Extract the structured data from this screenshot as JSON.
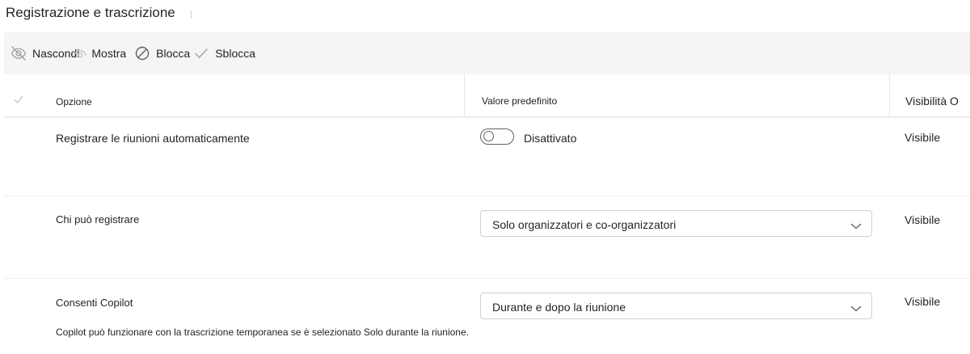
{
  "page": {
    "title": "Registrazione e trascrizione"
  },
  "toolbar": {
    "hide_label": "Nascondi",
    "show_label": "Mostra",
    "block_label": "Blocca",
    "unblock_label": "Sblocca"
  },
  "table": {
    "headers": {
      "option": "Opzione",
      "default_value": "Valore predefinito",
      "visibility": "Visibilità O"
    },
    "rows": [
      {
        "option": "Registrare le riunioni automaticamente",
        "control": "toggle",
        "toggle_on": false,
        "toggle_label": "Disattivato",
        "visibility": "Visibile"
      },
      {
        "option": "Chi può registrare",
        "control": "dropdown",
        "selected": "Solo organizzatori e co-organizzatori",
        "visibility": "Visibile"
      },
      {
        "option": "Consenti Copilot",
        "control": "dropdown",
        "selected": "Durante e dopo la riunione",
        "visibility": "Visibile",
        "note": "Copilot può funzionare con la trascrizione temporanea se è selezionato Solo durante la riunione."
      }
    ]
  },
  "icons": {
    "hide": "eye-off-icon",
    "show": "eye-icon",
    "block": "block-icon",
    "unblock": "checkmark-icon",
    "header_check": "checkmark-icon",
    "dropdown": "chevron-down-icon"
  },
  "colors": {
    "toolbar_bg": "#f5f5f5",
    "text": "#242424",
    "icon": "#616161",
    "muted_icon": "#bdbdbd",
    "border": "#d1d1d1"
  }
}
